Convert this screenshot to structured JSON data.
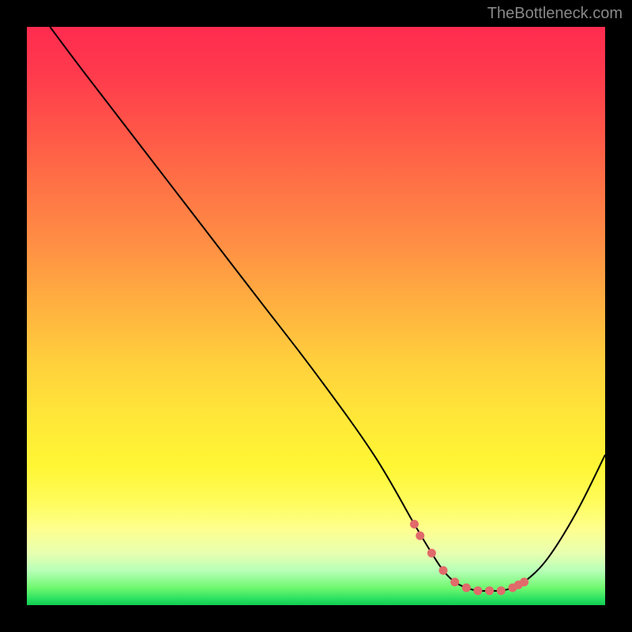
{
  "watermark": "TheBottleneck.com",
  "chart_data": {
    "type": "line",
    "title": "",
    "xlabel": "",
    "ylabel": "",
    "xlim": [
      0,
      100
    ],
    "ylim": [
      0,
      100
    ],
    "x": [
      4,
      10,
      20,
      30,
      40,
      50,
      60,
      67,
      70,
      72,
      74,
      76,
      78,
      80,
      82,
      84,
      86,
      90,
      95,
      100
    ],
    "y": [
      100,
      92,
      79,
      66,
      53,
      40,
      26,
      14,
      9,
      6,
      4,
      3,
      2.5,
      2.5,
      2.5,
      3,
      4,
      8,
      16,
      26
    ],
    "markers_x": [
      67,
      68,
      70,
      72,
      74,
      76,
      78,
      80,
      82,
      84,
      85,
      86
    ],
    "markers_y": [
      14,
      12,
      9,
      6,
      4,
      3,
      2.5,
      2.5,
      2.5,
      3,
      3.5,
      4
    ],
    "marker_color": "#e16a6a",
    "line_color": "#000000",
    "gradient": [
      "#ff2b4f",
      "#ffea34",
      "#10cc50"
    ]
  }
}
